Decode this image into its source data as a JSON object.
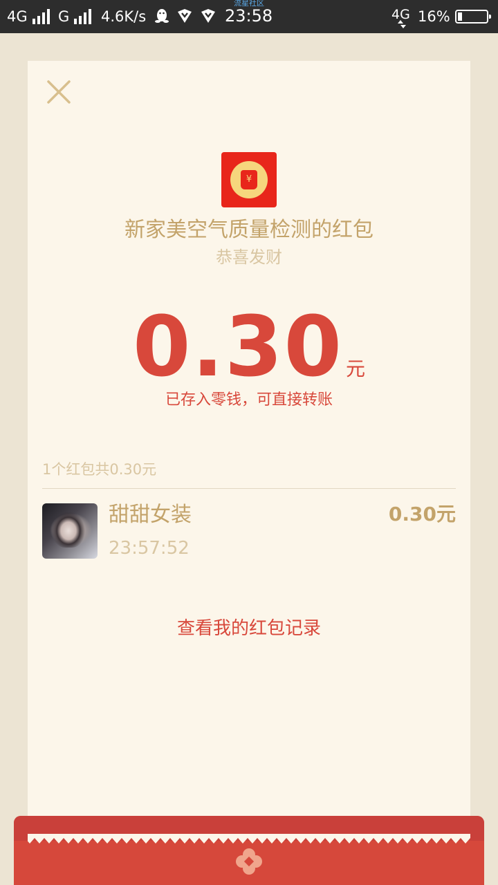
{
  "status_bar": {
    "network_1": "4G",
    "network_2": "G",
    "speed": "4.6K/s",
    "time": "23:58",
    "watermark": "流星社区",
    "network_3": "4G",
    "battery": "16%",
    "battery_level": 0.16
  },
  "card": {
    "close_icon": "close-icon",
    "red_packet_icon": "red-packet-icon",
    "sender_title": "新家美空气质量检测的红包",
    "wishing": "恭喜发财",
    "amount": "0.30",
    "amount_unit": "元",
    "saved_note": "已存入零钱，可直接转账",
    "summary": "1个红包共0.30元",
    "records": [
      {
        "name": "甜甜女装",
        "time": "23:57:52",
        "amount": "0.30元"
      }
    ],
    "history_link": "查看我的红包记录"
  },
  "colors": {
    "card_bg": "#fcf6ea",
    "page_bg": "#ece4d3",
    "gold": "#c3a36a",
    "light_gold": "#d9c6a2",
    "red": "#d8483b",
    "packet_red": "#e8261b"
  }
}
